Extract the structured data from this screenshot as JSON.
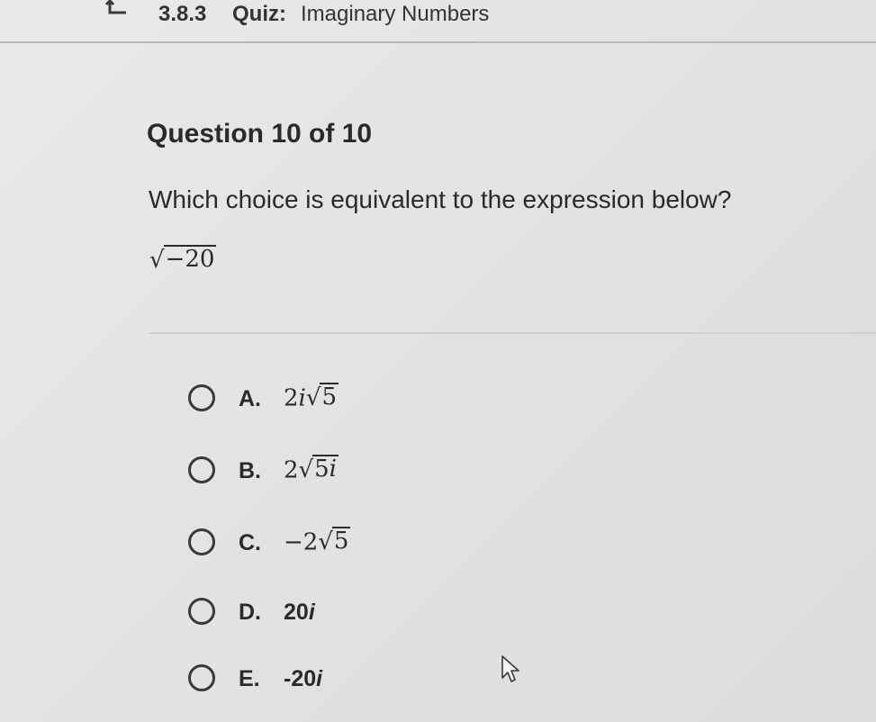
{
  "header": {
    "code": "3.8.3",
    "label": "Quiz:",
    "title": "Imaginary Numbers",
    "back_icon": "back-arrow-icon"
  },
  "question": {
    "number_text": "Question 10 of 10",
    "prompt": "Which choice is equivalent to the expression below?",
    "expression": {
      "radicand": "−20"
    }
  },
  "choices": [
    {
      "letter": "A.",
      "coef": "2",
      "coef_i": "i",
      "radicand": "5"
    },
    {
      "letter": "B.",
      "coef": "2",
      "radicand": "5",
      "radicand_i": "i"
    },
    {
      "letter": "C.",
      "coef": "−2",
      "radicand": "5"
    },
    {
      "letter": "D.",
      "text": "20",
      "text_i": "i"
    },
    {
      "letter": "E.",
      "text": "-20",
      "text_i": "i"
    }
  ],
  "colors": {
    "background": "#e4e4e2",
    "text": "#2a2a2a",
    "rule": "#b9b9b7"
  },
  "icons": {
    "cursor": "mouse-pointer-icon",
    "radio": "radio-button-icon"
  }
}
